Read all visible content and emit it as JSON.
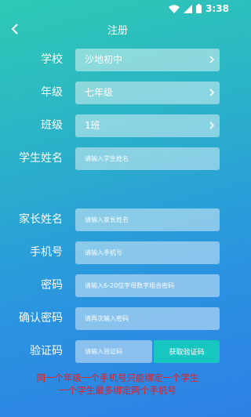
{
  "status_bar": {
    "time": "3:38"
  },
  "header": {
    "title": "注册"
  },
  "form": {
    "school": {
      "label": "学校",
      "value": "沙地初中"
    },
    "grade": {
      "label": "年级",
      "value": "七年级"
    },
    "class": {
      "label": "班级",
      "value": "1班"
    },
    "student_name": {
      "label": "学生姓名",
      "placeholder": "请输入学生姓名"
    },
    "parent_name": {
      "label": "家长姓名",
      "placeholder": "请输入家长姓名"
    },
    "phone": {
      "label": "手机号",
      "placeholder": "请输入手机号"
    },
    "password": {
      "label": "密码",
      "placeholder": "请输入6-20位字母数字组合密码"
    },
    "confirm_password": {
      "label": "确认密码",
      "placeholder": "请再次输入密码"
    },
    "verification_code": {
      "label": "验证码",
      "placeholder": "请输入验证码",
      "button_label": "获取验证码"
    }
  },
  "notice": {
    "line1": "同一个年级一个手机号只能绑定一个学生",
    "line2": "一个学生最多绑定两个手机号"
  },
  "colors": {
    "accent": "#17c6c0",
    "notice": "#e51d1d"
  },
  "icons": {
    "back": "chevron-left-icon",
    "select": "chevron-right-icon",
    "wifi": "wifi-icon",
    "signal": "signal-icon",
    "battery": "battery-icon"
  }
}
